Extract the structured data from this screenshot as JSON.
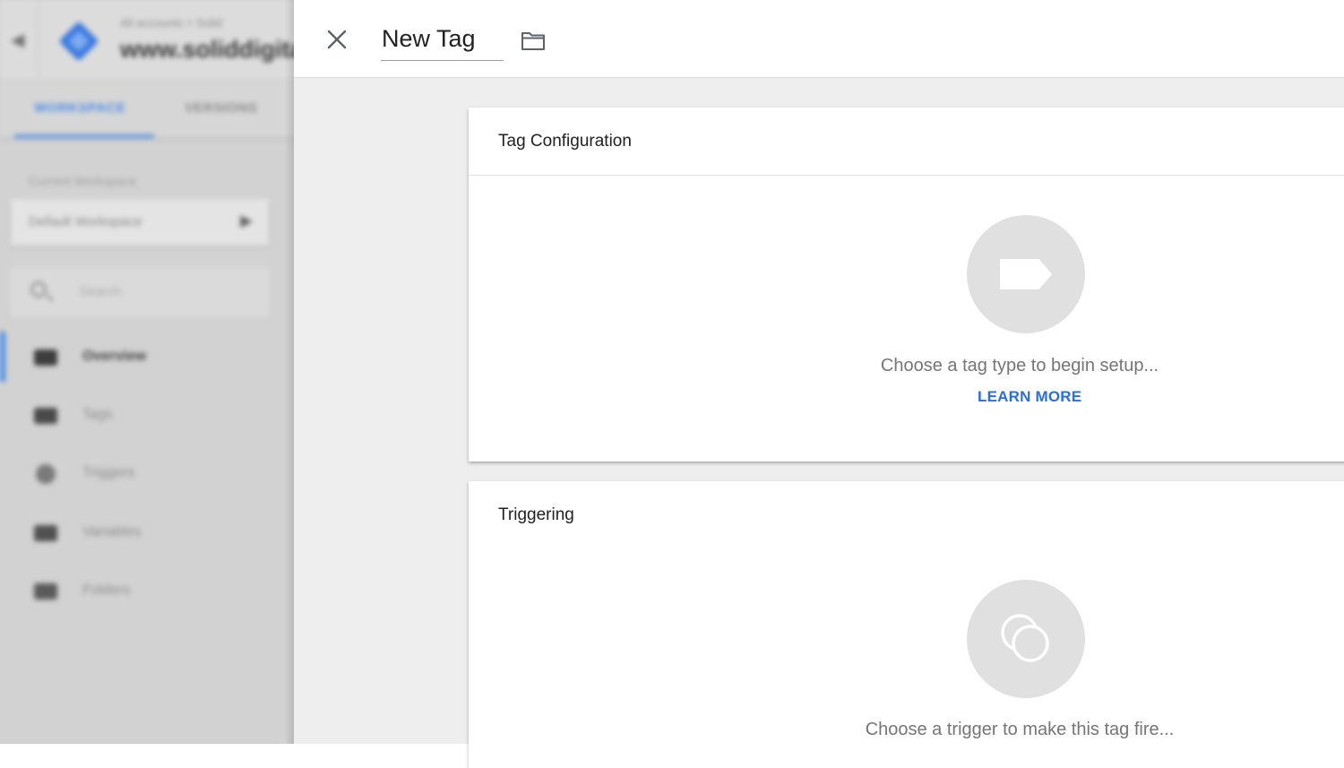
{
  "background": {
    "account_line": "All accounts > Solid",
    "container_name": "www.soliddigital.com",
    "tabs": [
      "WORKSPACE",
      "VERSIONS"
    ],
    "workspace_label": "Current Workspace",
    "workspace_name": "Default Workspace",
    "search_placeholder": "Search",
    "nav_items": [
      "Overview",
      "Tags",
      "Triggers",
      "Variables",
      "Folders"
    ],
    "accent_color": "#4e8de6"
  },
  "panel": {
    "close_icon": "close-icon",
    "tag_name": "New Tag",
    "folder_icon": "folder-icon"
  },
  "tag_configuration": {
    "title": "Tag Configuration",
    "icon": "tag-icon",
    "hint": "Choose a tag type to begin setup...",
    "link": "LEARN MORE",
    "link_color": "#2a6fd6"
  },
  "triggering": {
    "title": "Triggering",
    "icon": "trigger-icon",
    "hint": "Choose a trigger to make this tag fire..."
  }
}
